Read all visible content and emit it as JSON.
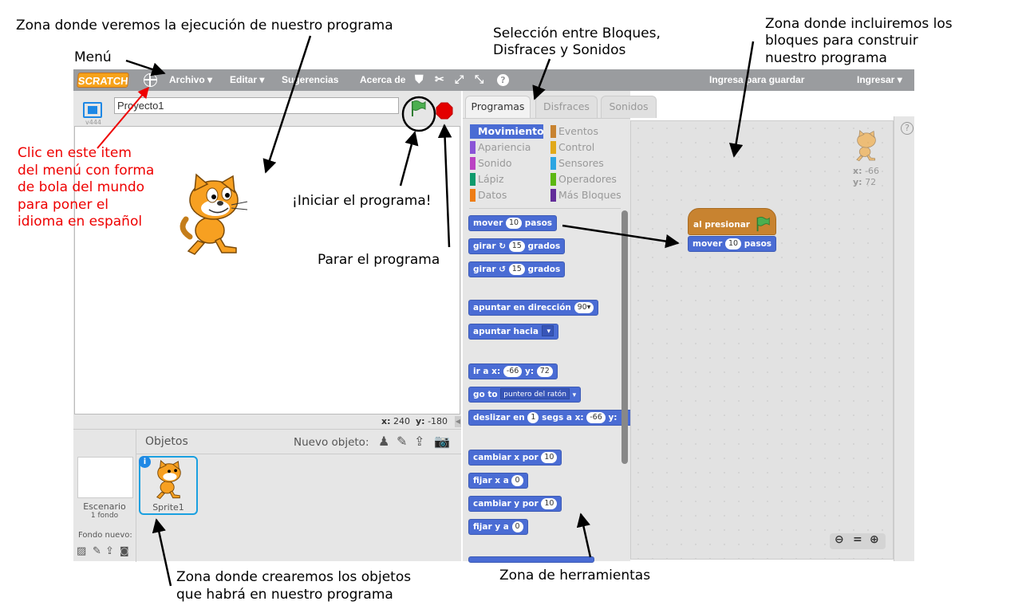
{
  "annotations": {
    "execution_zone": "Zona donde veremos la ejecución de nuestro programa",
    "menu": "Menú",
    "tabs_selection_line1": "Selección entre Bloques,",
    "tabs_selection_line2": "Disfraces y Sonidos",
    "scripts_zone_line1": "Zona donde incluiremos los",
    "scripts_zone_line2": "bloques para construir",
    "scripts_zone_line3": "nuestro programa",
    "globe_line1": "Clic en este item",
    "globe_line2": "del menú con forma",
    "globe_line3": "de bola del mundo",
    "globe_line4": "para poner el",
    "globe_line5": "idioma en español",
    "start_program": "¡Iniciar el programa!",
    "stop_program": "Parar el programa",
    "objects_zone_line1": "Zona donde crearemos los objetos",
    "objects_zone_line2": "que habrá en nuestro programa",
    "tools_zone": "Zona de herramientas"
  },
  "menubar": {
    "logo": "SCRATCH",
    "archivo": "Archivo ▾",
    "editar": "Editar ▾",
    "sugerencias": "Sugerencias",
    "acerca": "Acerca de",
    "signin_save": "Ingresa para guardar",
    "signin": "Ingresar ▾"
  },
  "stage": {
    "project_name": "Proyecto1",
    "version": "v444",
    "x_label": "x:",
    "x_value": "240",
    "y_label": "y:",
    "y_value": "-180"
  },
  "sprites": {
    "header": "Objetos",
    "new_object": "Nuevo objeto:",
    "stage_label": "Escenario",
    "stage_backdrops": "1 fondo",
    "new_backdrop": "Fondo nuevo:",
    "sprite_name": "Sprite1"
  },
  "tabs": {
    "code": "Programas",
    "costumes": "Disfraces",
    "sounds": "Sonidos"
  },
  "categories": {
    "motion": "Movimiento",
    "looks": "Apariencia",
    "sound": "Sonido",
    "pen": "Lápiz",
    "data": "Datos",
    "events": "Eventos",
    "control": "Control",
    "sensing": "Sensores",
    "operators": "Operadores",
    "more": "Más Bloques"
  },
  "colors": {
    "motion": "#4a6cd4",
    "looks": "#8a55d7",
    "sound": "#bb42c3",
    "pen": "#0e9a6c",
    "data": "#ee7d16",
    "events": "#c88330",
    "control": "#e1a91a",
    "sensing": "#2ca5e2",
    "operators": "#5cb712",
    "more": "#632d99"
  },
  "blocks": {
    "move": "mover",
    "steps": "pasos",
    "ten": "10",
    "turn": "girar",
    "fifteen": "15",
    "degrees": "grados",
    "point_dir": "apuntar en dirección",
    "ninety": "90▾",
    "point_towards": "apuntar hacia",
    "goto_xy": "ir a x:",
    "x_val": "-66",
    "y_lbl": "y:",
    "y_val": "72",
    "goto": "go to",
    "mouse": "puntero del ratón",
    "glide": "deslizar en",
    "one": "1",
    "glide_mid": "segs a x:",
    "change_x": "cambiar x por",
    "set_x": "fijar x a",
    "zero": "0",
    "change_y": "cambiar y por",
    "set_y": "fijar y a"
  },
  "scripts": {
    "hat": "al presionar",
    "move": "mover",
    "ten": "10",
    "steps": "pasos",
    "sprite_x_label": "x:",
    "sprite_x": "-66",
    "sprite_y_label": "y:",
    "sprite_y": "72"
  }
}
